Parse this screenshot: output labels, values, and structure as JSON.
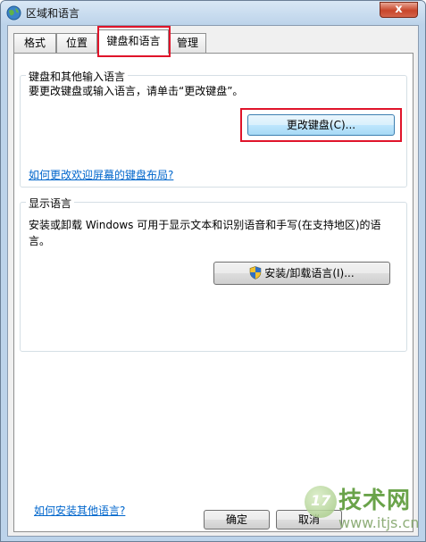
{
  "window": {
    "title": "区域和语言",
    "close_label": "x"
  },
  "tabs": [
    {
      "label": "格式"
    },
    {
      "label": "位置"
    },
    {
      "label": "键盘和语言"
    },
    {
      "label": "管理"
    }
  ],
  "keyboard_group": {
    "title": "键盘和其他输入语言",
    "description": "要更改键盘或输入语言，请单击“更改键盘”。",
    "change_button": "更改键盘(C)...",
    "welcome_link": "如何更改欢迎屏幕的键盘布局?"
  },
  "display_group": {
    "title": "显示语言",
    "description_line1": "安装或卸载 Windows 可用于显示文本和识别语音和手写(在支持地区)的语",
    "description_line2": "言。",
    "install_button": "安装/卸载语言(I)..."
  },
  "footer": {
    "install_link": "如何安装其他语言?",
    "ok_button": "确定",
    "cancel_button": "取消"
  },
  "watermark": {
    "logo": "17",
    "brand": "技术网",
    "url": "www.itjs.cn"
  },
  "colors": {
    "highlight": "#e0142a",
    "link": "#0066cc",
    "frame": "#bcd3ea"
  }
}
